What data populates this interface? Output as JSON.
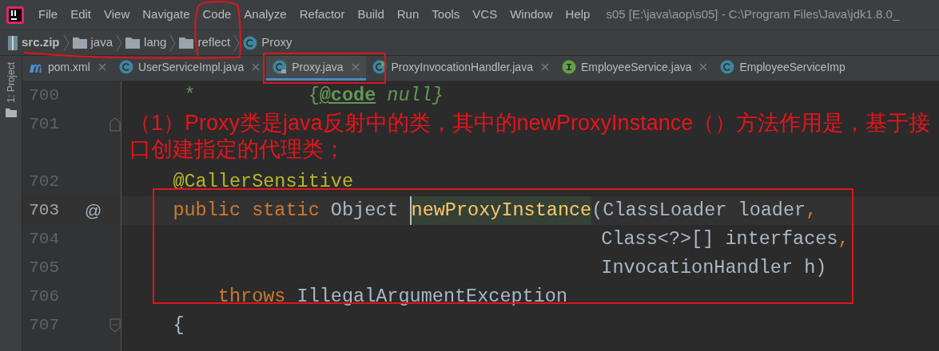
{
  "menu": {
    "items": [
      {
        "label": "File"
      },
      {
        "label": "Edit"
      },
      {
        "label": "View"
      },
      {
        "label": "Navigate"
      },
      {
        "label": "Code"
      },
      {
        "label": "Analyze"
      },
      {
        "label": "Refactor"
      },
      {
        "label": "Build"
      },
      {
        "label": "Run"
      },
      {
        "label": "Tools"
      },
      {
        "label": "VCS"
      },
      {
        "label": "Window"
      },
      {
        "label": "Help"
      }
    ],
    "title": "s05 [E:\\java\\aop\\s05] - C:\\Program Files\\Java\\jdk1.8.0_"
  },
  "breadcrumb": [
    {
      "label": "src.zip",
      "kind": "archive"
    },
    {
      "label": "java",
      "kind": "folder"
    },
    {
      "label": "lang",
      "kind": "folder"
    },
    {
      "label": "reflect",
      "kind": "folder"
    },
    {
      "label": "Proxy",
      "kind": "class"
    }
  ],
  "tool_stripe": {
    "label": "1: Project"
  },
  "tabs": [
    {
      "label": "pom.xml",
      "kind": "maven",
      "selected": false,
      "closable": true
    },
    {
      "label": "UserServiceImpl.java",
      "kind": "class",
      "selected": false,
      "closable": true
    },
    {
      "label": "Proxy.java",
      "kind": "class-locked",
      "selected": true,
      "closable": true
    },
    {
      "label": "ProxyInvocationHandler.java",
      "kind": "class-runnable",
      "selected": false,
      "closable": true
    },
    {
      "label": "EmployeeService.java",
      "kind": "interface",
      "selected": false,
      "closable": true
    },
    {
      "label": "EmployeeServiceImp",
      "kind": "class",
      "selected": false,
      "closable": false
    }
  ],
  "editor": {
    "lines": [
      {
        "kind": "code",
        "number": "700",
        "current": false,
        "tokens": [
          {
            "kind": "doc",
            "text": "     *          {"
          },
          {
            "kind": "doc-tag",
            "text": "@code"
          },
          {
            "kind": "doc-italic",
            "text": " null}"
          }
        ]
      },
      {
        "kind": "code",
        "number": "701",
        "current": false,
        "fold_end": true
      },
      {
        "kind": "inlay"
      },
      {
        "kind": "code",
        "number": "702",
        "current": false,
        "tokens": [
          {
            "kind": "annotation",
            "text": "    @CallerSensitive"
          }
        ]
      },
      {
        "kind": "code",
        "number": "703",
        "current": true,
        "gutter_mark": "@",
        "tokens": [
          {
            "kind": "keyword",
            "text": "    public static "
          },
          {
            "kind": "plain",
            "text": "Object "
          },
          {
            "kind": "method-decl",
            "text": "newProxyInstance",
            "caret": true
          },
          {
            "kind": "plain",
            "text": "(ClassLoader loader"
          },
          {
            "kind": "punct",
            "text": ","
          }
        ]
      },
      {
        "kind": "code",
        "number": "704",
        "current": false,
        "tokens": [
          {
            "kind": "plain",
            "text": "                                          Class<?>[] interfaces"
          },
          {
            "kind": "punct",
            "text": ","
          }
        ]
      },
      {
        "kind": "code",
        "number": "705",
        "current": false,
        "tokens": [
          {
            "kind": "plain",
            "text": "                                          InvocationHandler h)"
          }
        ]
      },
      {
        "kind": "code",
        "number": "706",
        "current": false,
        "tokens": [
          {
            "kind": "keyword",
            "text": "        throws "
          },
          {
            "kind": "plain",
            "text": "IllegalArgumentException"
          }
        ]
      },
      {
        "kind": "code",
        "number": "707",
        "current": false,
        "fold_start": true,
        "tokens": [
          {
            "kind": "plain",
            "text": "    {"
          }
        ]
      }
    ]
  },
  "annotation": {
    "note": "（1）Proxy类是java反射中的类，其中的newProxyInstance（）方法作用是，基于接口创建指定的代理类；"
  }
}
